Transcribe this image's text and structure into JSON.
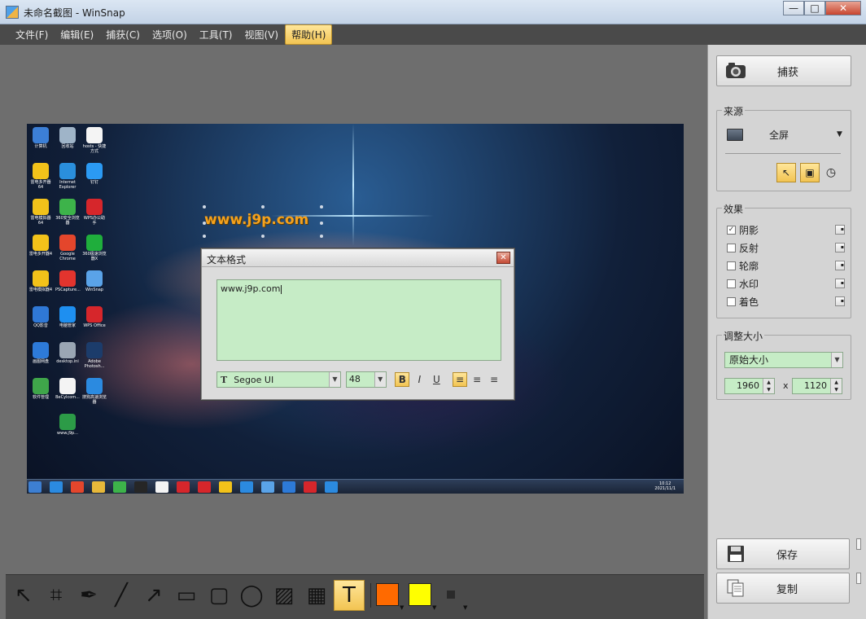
{
  "window": {
    "title": "未命名截图 - WinSnap",
    "buttons": {
      "minimize": "—",
      "maximize": "□",
      "close": "✕"
    }
  },
  "menu": {
    "items": [
      "文件(F)",
      "编辑(E)",
      "捕获(C)",
      "选项(O)",
      "工具(T)",
      "视图(V)",
      "帮助(H)"
    ],
    "active": "帮助(H)"
  },
  "screenshot": {
    "watermark_text": "www.j9p.com",
    "desktop_icons": [
      {
        "label": "计算机",
        "color": "#3c7fd6"
      },
      {
        "label": "回收站",
        "color": "#9fb4c8"
      },
      {
        "label": "hosts - 快捷方式",
        "color": "#f4f4f4"
      },
      {
        "label": "雷电多开器64",
        "color": "#f2c21a"
      },
      {
        "label": "Internet Explorer",
        "color": "#2a8fdc"
      },
      {
        "label": "钉钉",
        "color": "#2b9af3"
      },
      {
        "label": "雷电模拟器64",
        "color": "#f2c21a"
      },
      {
        "label": "360安全浏览器",
        "color": "#3db34a"
      },
      {
        "label": "WPS办公助手",
        "color": "#d6262b"
      },
      {
        "label": "雷电多开器4",
        "color": "#f2c21a"
      },
      {
        "label": "Google Chrome",
        "color": "#e4462c"
      },
      {
        "label": "360极速浏览器X",
        "color": "#1fae3c"
      },
      {
        "label": "雷电模拟器4",
        "color": "#f2c21a"
      },
      {
        "label": "PSCapture...",
        "color": "#e2342e"
      },
      {
        "label": "WinSnap",
        "color": "#5aa3e8"
      },
      {
        "label": "QQ影音",
        "color": "#2f78d6"
      },
      {
        "label": "电脑管家",
        "color": "#1e8ff0"
      },
      {
        "label": "WPS Office",
        "color": "#d6262b"
      },
      {
        "label": "画图网盘",
        "color": "#2d7ad8"
      },
      {
        "label": "desktop.ini",
        "color": "#9aa6b4"
      },
      {
        "label": "Adobe Photosh...",
        "color": "#1c3c6b"
      },
      {
        "label": "软件管理",
        "color": "#3fa64a"
      },
      {
        "label": "BeCylcom...",
        "color": "#f4f4f4"
      },
      {
        "label": "搜狗高速浏览器",
        "color": "#2b8ae0"
      },
      {
        "label": "www.j9p...",
        "color": "#2c9b47"
      }
    ],
    "taskbar_icons": [
      "#3d7fd2",
      "#2b8ae0",
      "#e4462c",
      "#e7b83a",
      "#3db34a",
      "#262626",
      "#f4f4f4",
      "#d6262b",
      "#d6262b",
      "#f2c21a",
      "#2b8ae0",
      "#5aa3e8",
      "#2d7ad8",
      "#d6262b",
      "#2b8ae0"
    ],
    "clock": {
      "time": "10:12",
      "date": "2021/11/1"
    }
  },
  "text_format_dialog": {
    "title": "文本格式",
    "text_value": "www.j9p.com",
    "font_name": "Segoe UI",
    "font_size": "48",
    "format_buttons": [
      {
        "name": "bold-button",
        "label": "B",
        "on": true
      },
      {
        "name": "italic-button",
        "label": "I",
        "on": false
      },
      {
        "name": "underline-button",
        "label": "U",
        "on": false
      }
    ],
    "align_buttons": [
      {
        "name": "align-left-button",
        "label": "≡",
        "on": true
      },
      {
        "name": "align-center-button",
        "label": "≡",
        "on": false
      },
      {
        "name": "align-right-button",
        "label": "≡",
        "on": false
      }
    ]
  },
  "right_panel": {
    "capture_label": "捕获",
    "source": {
      "title": "来源",
      "mode": "全屏"
    },
    "effects": {
      "title": "效果",
      "items": [
        {
          "label": "阴影",
          "checked": true
        },
        {
          "label": "反射",
          "checked": false
        },
        {
          "label": "轮廓",
          "checked": false
        },
        {
          "label": "水印",
          "checked": false
        },
        {
          "label": "着色",
          "checked": false
        }
      ]
    },
    "resize": {
      "title": "调整大小",
      "mode": "原始大小",
      "width": "1960",
      "height": "1120",
      "times": "x"
    },
    "save_label": "保存",
    "copy_label": "复制"
  },
  "toolbar": {
    "tools": [
      {
        "name": "pointer-tool",
        "glyph": "↖"
      },
      {
        "name": "crop-tool",
        "glyph": "⌗"
      },
      {
        "name": "pen-tool",
        "glyph": "✒"
      },
      {
        "name": "line-tool",
        "glyph": "╱"
      },
      {
        "name": "arrow-tool",
        "glyph": "↗"
      },
      {
        "name": "rectangle-tool",
        "glyph": "▭"
      },
      {
        "name": "rounded-rectangle-tool",
        "glyph": "▢"
      },
      {
        "name": "ellipse-tool",
        "glyph": "◯"
      },
      {
        "name": "hatch-tool",
        "glyph": "▨"
      },
      {
        "name": "pixelate-tool",
        "glyph": "▦"
      },
      {
        "name": "text-tool",
        "glyph": "T"
      }
    ],
    "active_tool": "text-tool",
    "colors": {
      "primary": "#ff6a00",
      "secondary": "#ffff00",
      "style": "#2a2a2a"
    }
  }
}
